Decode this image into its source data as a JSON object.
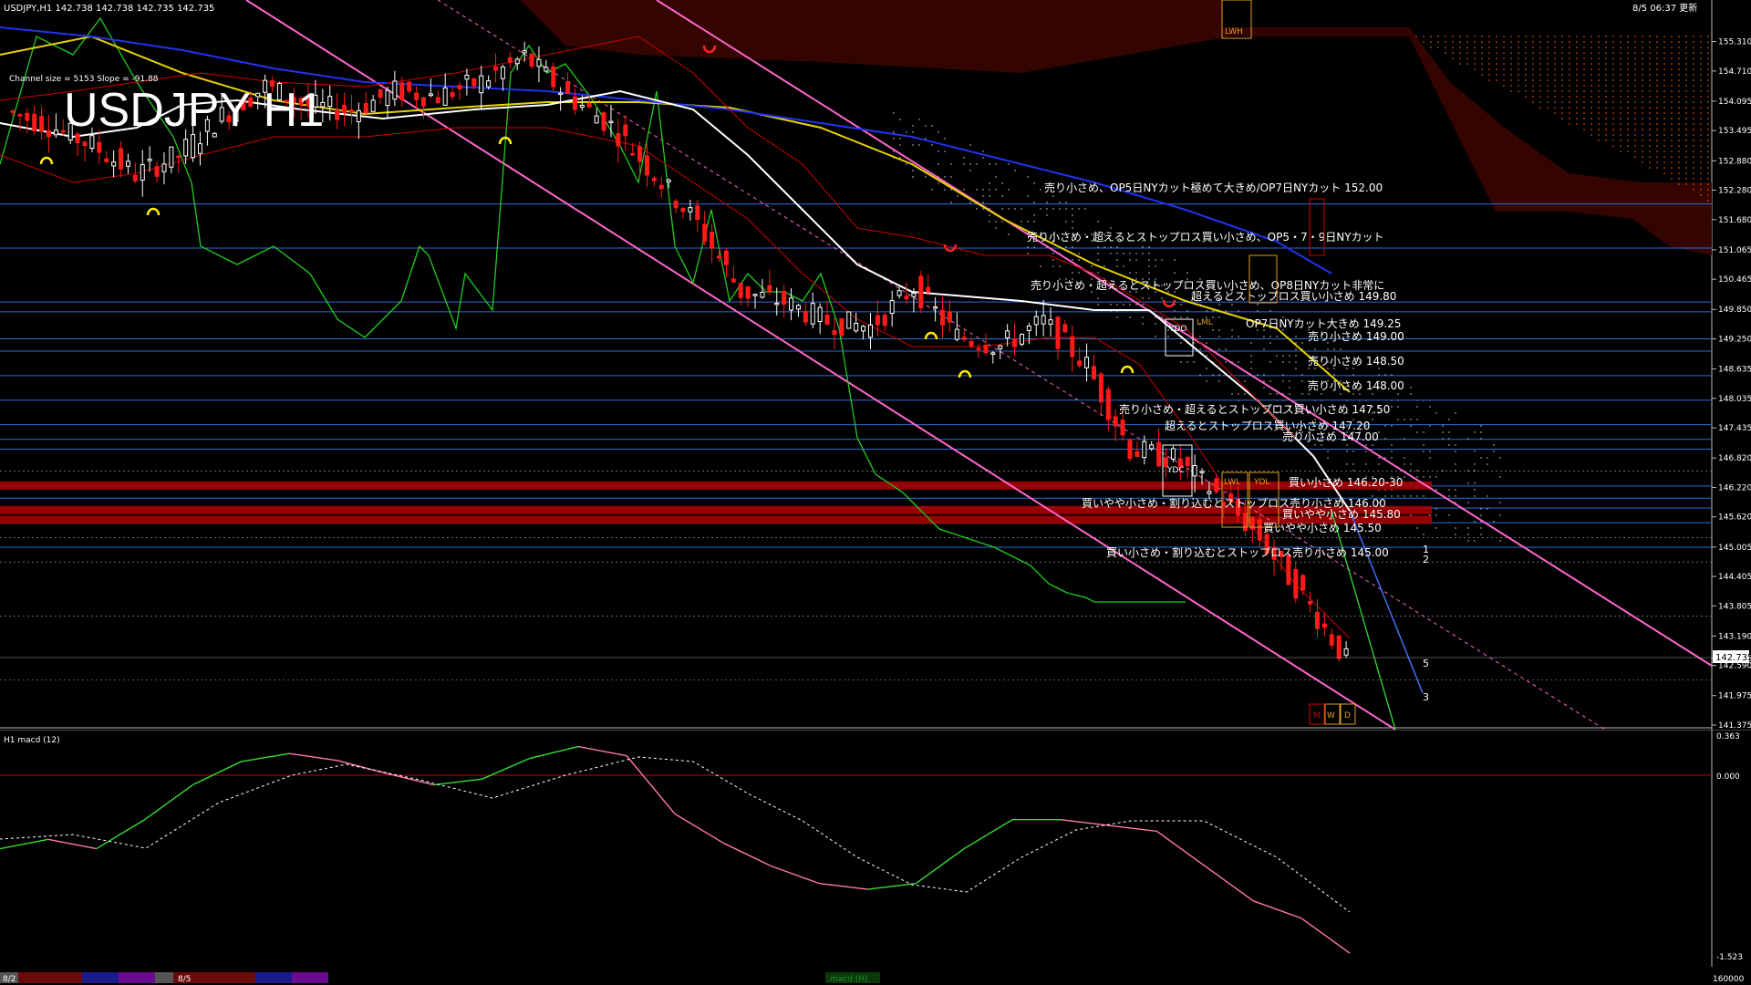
{
  "header": {
    "symbol_info": "USDJPY,H1  142.738 142.738 142.735 142.735",
    "big_title": "USDJPY H1",
    "channel_info": "Channel size = 5153 Slope = -91.88",
    "clock": "8/5 06:37 更新"
  },
  "colors": {
    "up": "#ffffff",
    "down": "#ff1a1a",
    "hline": "#2f6dd8",
    "red_zone": "#b00000",
    "channel": "#ff66cc",
    "kumo": "#ff6600"
  },
  "macd": {
    "title": "H1  macd (12)",
    "top_label": "0.363",
    "zero_label": "0.000",
    "bottom_label": "-1.523",
    "scroll_label": "160000"
  },
  "status": {
    "date1": "8/2",
    "date2": "8/5",
    "macd_tab": "macd (H)"
  },
  "chart_data": [
    {
      "type": "line",
      "title": "USDJPY H1",
      "y_ticks": [
        "155.310",
        "154.710",
        "154.095",
        "153.495",
        "152.880",
        "152.280",
        "151.680",
        "151.065",
        "150.465",
        "149.850",
        "149.250",
        "148.635",
        "148.035",
        "147.435",
        "146.820",
        "146.220",
        "145.620",
        "145.005",
        "144.405",
        "143.805",
        "143.190",
        "142.735",
        "142.590",
        "141.975",
        "141.375"
      ],
      "ylim": [
        141.375,
        155.6
      ],
      "current_price": "142.735",
      "levels": [
        {
          "price": 152.0,
          "label": "売り小さめ、OP5日NYカット極めて大きめ/OP7日NYカット 152.00"
        },
        {
          "price": 151.1,
          "label": "売り小さめ・超えるとストップロス買い小さめ、OP5・7・9日NYカット"
        },
        {
          "price": 150.0,
          "label": "売り小さめ・超えるとストップロス買い小さめ、OP8日NYカット非常に"
        },
        {
          "price": 149.8,
          "label": "超えるとストップロス買い小さめ 149.80"
        },
        {
          "price": 149.25,
          "label": "OP7日NYカット大きめ 149.25"
        },
        {
          "price": 149.0,
          "label": "売り小さめ 149.00"
        },
        {
          "price": 148.5,
          "label": "売り小さめ 148.50"
        },
        {
          "price": 148.0,
          "label": "売り小さめ 148.00"
        },
        {
          "price": 147.5,
          "label": "売り小さめ・超えるとストップロス買い小さめ 147.50"
        },
        {
          "price": 147.2,
          "label": "超えるとストップロス買い小さめ 147.20"
        },
        {
          "price": 147.0,
          "label": "売り小さめ 147.00"
        },
        {
          "price": 146.25,
          "label": "買い小さめ 146.20-30"
        },
        {
          "price": 146.0,
          "label": "買いやや小さめ・割り込むとストップロス売り小さめ 146.00"
        },
        {
          "price": 145.8,
          "label": "買いやや小さめ 145.80"
        },
        {
          "price": 145.5,
          "label": "買いやや小さめ 145.50"
        },
        {
          "price": 145.0,
          "label": "買い小さめ・割り込むとストップロス売り小さめ 145.00"
        }
      ],
      "markers": [
        "LWH",
        "YDC",
        "YDO",
        "YDL",
        "LWL",
        "LML",
        "M",
        "W",
        "D",
        "1",
        "2",
        "3",
        "5"
      ],
      "series": [
        {
          "name": "",
          "values": [
            153.9,
            153.6,
            153.2,
            152.6,
            153.0,
            153.8,
            154.4,
            154.0,
            153.9,
            154.3,
            154.2,
            154.5,
            155.0,
            154.2,
            153.6,
            152.6,
            151.6,
            150.2,
            150.0,
            149.6,
            149.5,
            150.3,
            149.3,
            149.1,
            149.6,
            148.7,
            147.0,
            146.8,
            146.1,
            145.2,
            144.0,
            142.7
          ]
        }
      ]
    },
    {
      "type": "line",
      "title": "H1  macd (12)",
      "ylim": [
        -1.523,
        0.363
      ],
      "series": [
        {
          "name": "",
          "values": [
            -0.6,
            -0.52,
            -0.6,
            -0.35,
            -0.05,
            0.15,
            0.22,
            0.16,
            0.05,
            -0.05,
            0.0,
            0.18,
            0.28,
            0.2,
            -0.3,
            -0.55,
            -0.75,
            -0.9,
            -0.95,
            -0.9,
            -0.6,
            -0.35,
            -0.35,
            -0.4,
            -0.45,
            -0.75,
            -1.05,
            -1.2,
            -1.5
          ]
        }
      ]
    }
  ]
}
